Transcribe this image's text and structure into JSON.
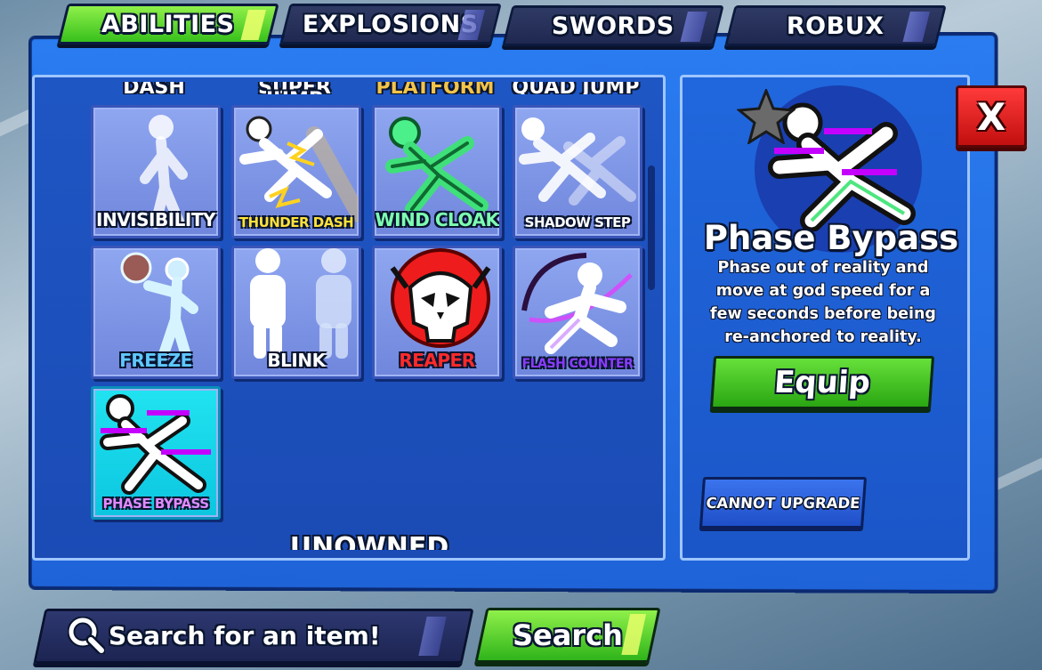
{
  "tabs": [
    {
      "label": "ABILITIES",
      "active": true
    },
    {
      "label": "EXPLOSIONS",
      "active": false
    },
    {
      "label": "SWORDS",
      "active": false
    },
    {
      "label": "ROBUX",
      "active": false
    }
  ],
  "partial_row": [
    "DASH",
    "SUPER JUMP",
    "PLATFORM",
    "QUAD JUMP"
  ],
  "abilities": [
    {
      "name": "INVISIBILITY",
      "label_color": "#ffffff",
      "icon": "invisible-runner-icon"
    },
    {
      "name": "THUNDER DASH",
      "label_color": "#ffe23a",
      "icon": "thunder-dash-icon"
    },
    {
      "name": "WIND CLOAK",
      "label_color": "#7dffb0",
      "icon": "wind-cloak-icon"
    },
    {
      "name": "SHADOW STEP",
      "label_color": "#ffffff",
      "icon": "shadow-step-icon"
    },
    {
      "name": "FREEZE",
      "label_color": "#5fc8ff",
      "icon": "freeze-icon"
    },
    {
      "name": "BLINK",
      "label_color": "#ffffff",
      "icon": "blink-icon"
    },
    {
      "name": "REAPER",
      "label_color": "#ff2a2a",
      "icon": "reaper-skull-icon"
    },
    {
      "name": "FLASH COUNTER",
      "label_color": "#8a3cff",
      "icon": "flash-counter-icon"
    },
    {
      "name": "PHASE BYPASS",
      "label_color": "#e08aff",
      "icon": "phase-bypass-icon",
      "selected": true
    }
  ],
  "section_heading": "UNOWNED",
  "detail": {
    "title": "Phase Bypass",
    "description": "Phase out of reality and move at god speed for a few seconds before being re-anchored to reality.",
    "equip_label": "Equip",
    "upgrade_label": "CANNOT UPGRADE",
    "star_icon": "star-icon"
  },
  "close_label": "X",
  "search": {
    "placeholder": "Search for an item!",
    "button_label": "Search"
  },
  "colors": {
    "panel_blue": "#2a7cf0",
    "active_green": "#3cc21e",
    "close_red": "#e01a1a",
    "selected_cyan": "#14d8ea"
  }
}
